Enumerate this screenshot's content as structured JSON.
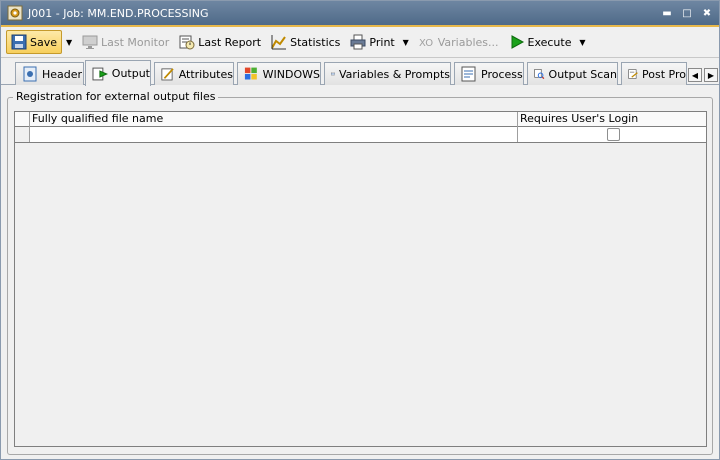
{
  "window": {
    "title": "J001 - Job: MM.END.PROCESSING",
    "minimize_glyph": "▬",
    "maximize_glyph": "□",
    "close_glyph": "✖"
  },
  "toolbar": {
    "save_label": "Save",
    "last_monitor_label": "Last Monitor",
    "last_report_label": "Last Report",
    "statistics_label": "Statistics",
    "print_label": "Print",
    "variables_label": "Variables...",
    "execute_label": "Execute",
    "dropdown_glyph": "▼"
  },
  "tabs": [
    {
      "label": "Header",
      "icon": "header-icon"
    },
    {
      "label": "Output",
      "icon": "output-icon",
      "selected": true
    },
    {
      "label": "Attributes",
      "icon": "attributes-icon"
    },
    {
      "label": "WINDOWS",
      "icon": "windows-icon"
    },
    {
      "label": "Variables & Prompts",
      "icon": "variables-icon"
    },
    {
      "label": "Process",
      "icon": "process-icon"
    },
    {
      "label": "Output Scan",
      "icon": "output-scan-icon"
    },
    {
      "label": "Post Pro",
      "icon": "post-process-icon"
    }
  ],
  "tab_scroll": {
    "left_glyph": "◀",
    "right_glyph": "▶"
  },
  "group": {
    "title": "Registration for external output files",
    "columns": [
      "",
      "Fully qualified file name",
      "Requires User's Login"
    ],
    "rows": [
      {
        "file_name": "",
        "requires_login": false
      }
    ]
  },
  "colors": {
    "titlebar": "#5a7594",
    "toolbar_accent": "#e8b84a",
    "window_bg": "#f0f0f0",
    "execute_green": "#1aa11a"
  }
}
